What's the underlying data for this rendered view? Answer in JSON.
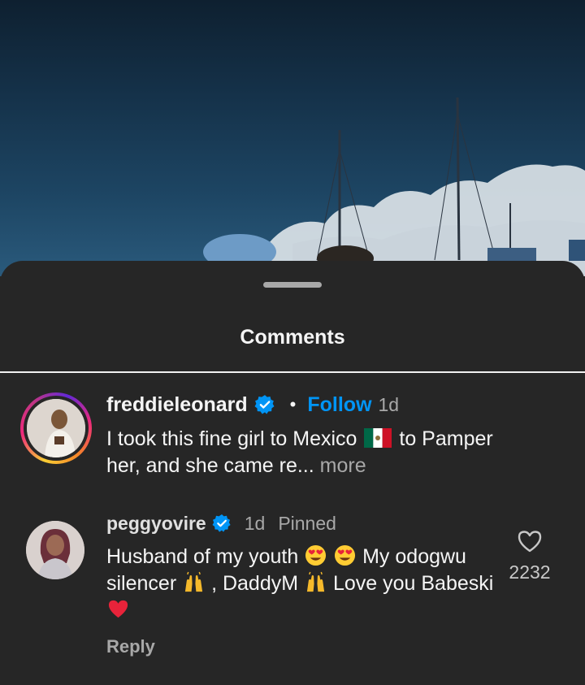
{
  "sheet": {
    "title": "Comments"
  },
  "caption": {
    "username": "freddieleonard",
    "separator": "•",
    "follow_label": "Follow",
    "time": "1d",
    "text_part1": "I took this fine girl to Mexico",
    "text_part2": "to Pamper her, and she came re...",
    "more_label": " more"
  },
  "comment": {
    "username": "peggyovire",
    "time": "1d",
    "pinned_label": "Pinned",
    "text_part1": "Husband of my youth",
    "text_part2": "My odogwu silencer",
    "text_part3": ", DaddyM",
    "text_part4": "Love you Babeski",
    "reply_label": "Reply",
    "like_count": "2232"
  },
  "icons": {
    "verified": "verified-badge-icon",
    "flag": "mexico-flag-icon",
    "heart_eyes": "heart-eyes-emoji-icon",
    "raised_hands": "raised-hands-emoji-icon",
    "red_heart": "red-heart-emoji-icon",
    "like": "heart-outline-icon"
  },
  "colors": {
    "background": "#262626",
    "accent_blue": "#0095f6",
    "secondary_text": "#a8a8a8"
  }
}
